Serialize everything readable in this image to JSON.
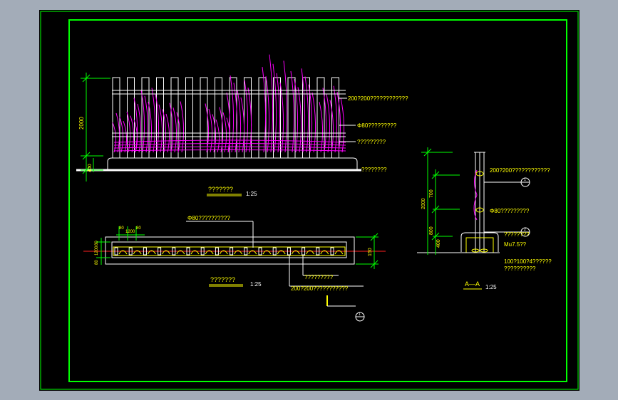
{
  "colors": {
    "background": "#000000",
    "frame": "#00ff00",
    "lines": "#ffffff",
    "dimensions": "#00ff00",
    "labels": "#ffff00",
    "infill": "#ff00ff",
    "centerline": "#ff2020"
  },
  "elevation": {
    "title": "???????",
    "scale": "1:25",
    "dim_total": "2000",
    "dim_base": "400",
    "notes": [
      "200?200????????????",
      "Φ80?????????",
      "?????????",
      "????????"
    ]
  },
  "plan": {
    "title": "???????",
    "scale": "1:25",
    "note_top": "Φ80??????????",
    "note_right": "?????????",
    "note_bottom": "200?200???????????",
    "dims_top": [
      "80",
      "1200",
      "80"
    ],
    "dims_left": [
      "80",
      "1200",
      "80"
    ],
    "dim_right": "150",
    "section_mark": "1"
  },
  "section": {
    "title": "A—A",
    "scale": "1:25",
    "dim_total": "2000",
    "dim_upper": "700",
    "dim_mid": "800",
    "dim_low": "400",
    "marker_1": "1",
    "marker_2": "2",
    "notes": [
      "200?200????????????",
      "Φ80?????????",
      "????????",
      "Mu7.5??",
      "100?100?4??????",
      "??????????"
    ]
  }
}
